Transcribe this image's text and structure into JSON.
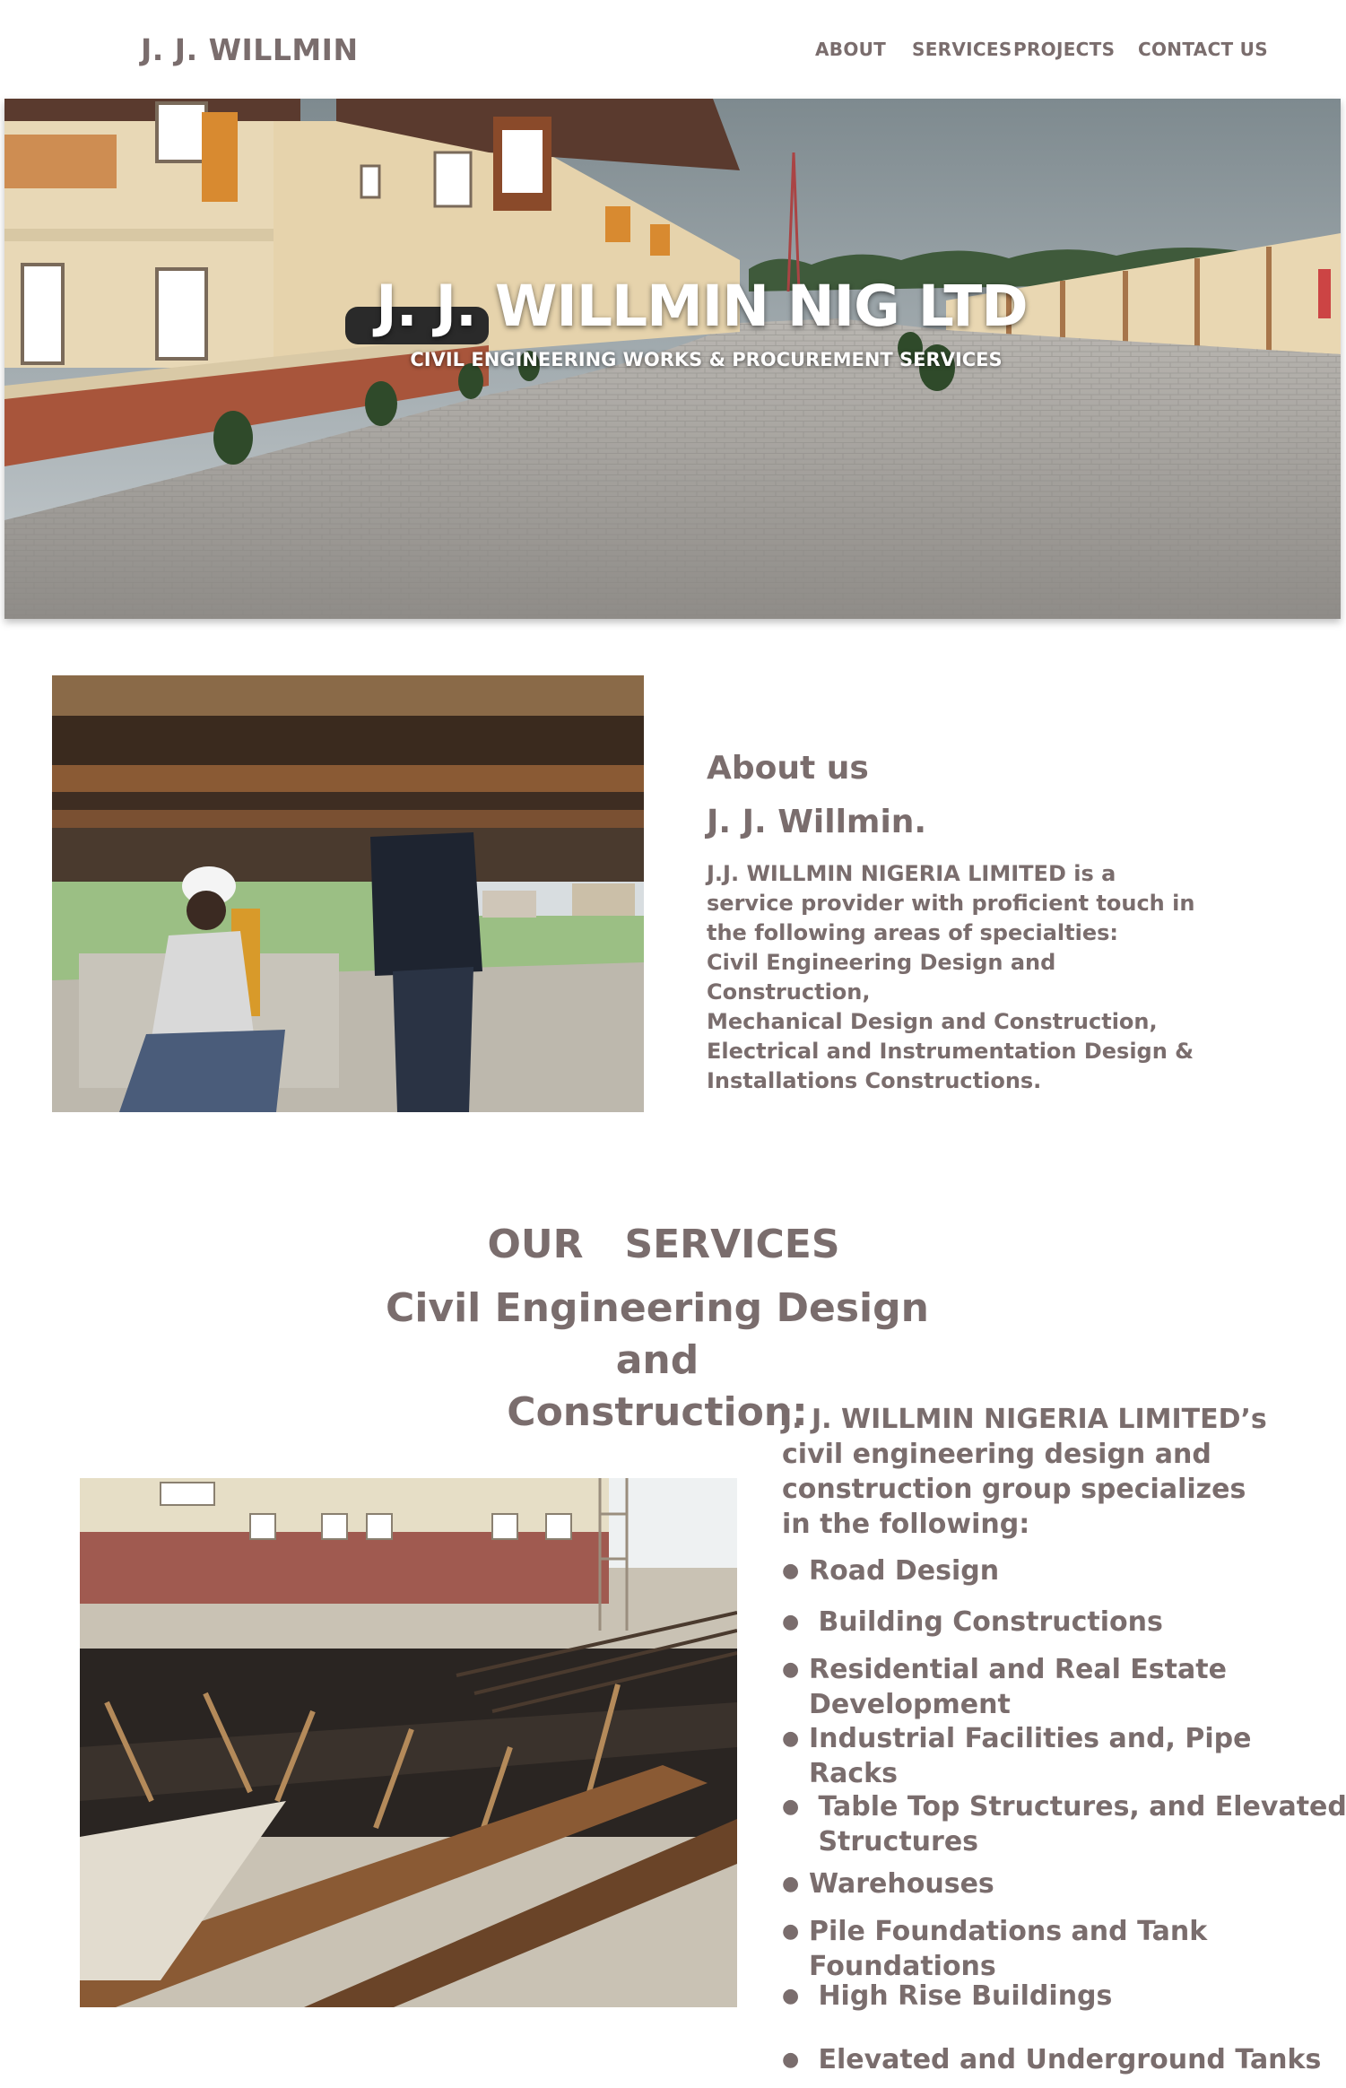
{
  "header": {
    "brand": "J. J. WILLMIN",
    "nav": [
      "ABOUT",
      "SERVICES",
      "PROJECTS",
      "CONTACT US"
    ]
  },
  "hero": {
    "title": "J. J. WILLMIN NIG LTD",
    "subtitle": "CIVIL ENGINEERING WORKS & PROCUREMENT SERVICES"
  },
  "about": {
    "heading": "About us",
    "name": "J. J. Willmin.",
    "lines": [
      "J.J. WILLMIN NIGERIA LIMITED is a",
      "service provider with proficient touch in",
      "the following areas of specialties:",
      "Civil Engineering Design and",
      "Construction,",
      "Mechanical Design and Construction,",
      "Electrical and Instrumentation Design &",
      "Installations Constructions."
    ]
  },
  "services": {
    "title": "OUR   SERVICES",
    "subtitle_line1": "Civil Engineering Design and",
    "subtitle_line2": "Construction:",
    "intro": [
      "J. J. WILLMIN NIGERIA LIMITED’s",
      "civil engineering design and",
      "construction group specializes",
      "in the following:"
    ],
    "items": [
      [
        "Road Design"
      ],
      [
        " Building Constructions"
      ],
      [
        "Residential and Real Estate",
        "Development"
      ],
      [
        "Industrial Facilities and, Pipe",
        "Racks"
      ],
      [
        " Table Top Structures, and Elevated",
        " Structures"
      ],
      [
        "Warehouses"
      ],
      [
        "Pile Foundations and Tank",
        "Foundations"
      ],
      [
        " High Rise Buildings"
      ],
      [
        " Elevated and Underground Tanks"
      ]
    ]
  },
  "colors": {
    "text": "#7a6d6d",
    "background": "#ffffff",
    "hero_text": "#ffffff"
  }
}
